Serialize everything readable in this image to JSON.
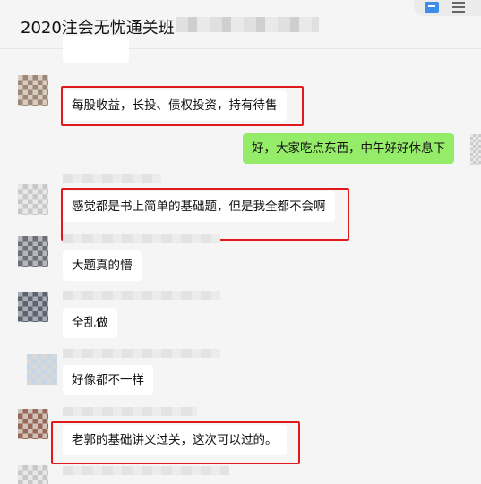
{
  "header": {
    "title": "2020注会无忧通关班"
  },
  "icons": {
    "screen": "screen-share-icon",
    "menu": "menu-icon"
  },
  "colors": {
    "highlight_border": "#e01a1a",
    "own_bubble": "#95ec69"
  },
  "messages": [
    {
      "text": "每股收益，长投、债权投资，持有待售",
      "highlighted": true
    },
    {
      "text": "好，大家吃点东西，中午好好休息下",
      "own": true
    },
    {
      "text": "感觉都是书上简单的基础题，但是我全都不会啊",
      "highlighted": true
    },
    {
      "text": "大题真的懵"
    },
    {
      "text": "全乱做"
    },
    {
      "text": "好像都不一样"
    },
    {
      "text": "老郭的基础讲义过关，这次可以过的。",
      "highlighted": true
    }
  ]
}
